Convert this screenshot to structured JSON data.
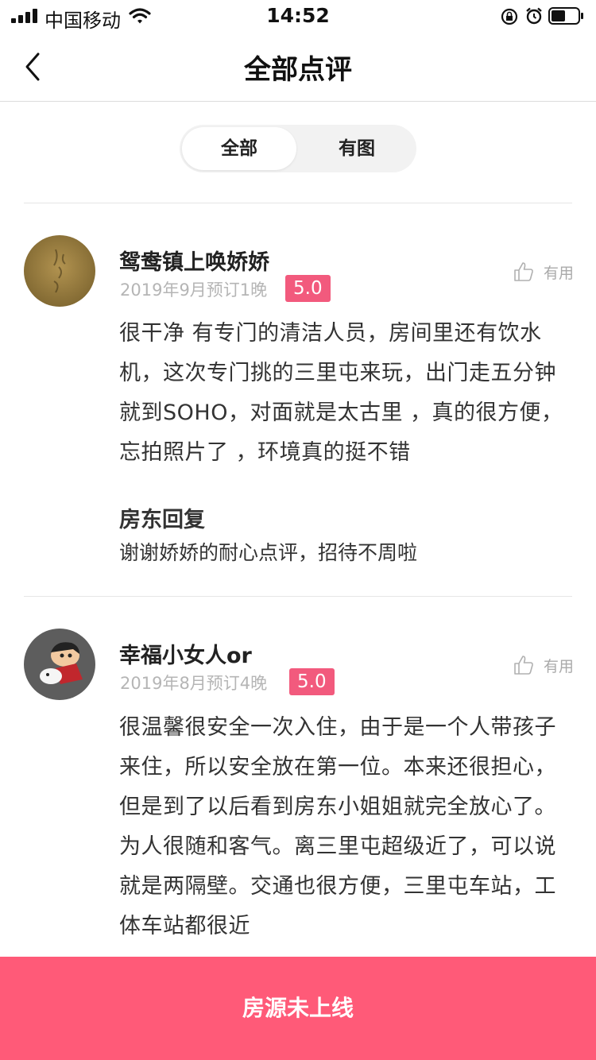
{
  "status_bar": {
    "carrier": "中国移动",
    "time": "14:52"
  },
  "nav": {
    "title": "全部点评"
  },
  "tabs": [
    {
      "label": "全部",
      "active": true
    },
    {
      "label": "有图",
      "active": false
    }
  ],
  "reviews": [
    {
      "name": "鸳鸯镇上唤娇娇",
      "meta": "2019年9月预订1晚",
      "score": "5.0",
      "useful_label": "有用",
      "content": "很干净 有专门的清洁人员，房间里还有饮水机，这次专门挑的三里屯来玩，出门走五分钟就到SOHO，对面就是太古里 ，真的很方便，忘拍照片了 ，环境真的挺不错",
      "reply_title": "房东回复",
      "reply_text": "谢谢娇娇的耐心点评，招待不周啦"
    },
    {
      "name": "幸福小女人or",
      "meta": "2019年8月预订4晚",
      "score": "5.0",
      "useful_label": "有用",
      "content": "很温馨很安全一次入住，由于是一个人带孩子来住，所以安全放在第一位。本来还很担心，但是到了以后看到房东小姐姐就完全放心了。为人很随和客气。离三里屯超级近了，可以说就是两隔壁。交通也很方便，三里屯车站，工体车站都很近"
    }
  ],
  "bottom_bar": {
    "label": "房源未上线"
  },
  "colors": {
    "accent": "#ff5a78",
    "score_badge": "#f25a7d"
  }
}
